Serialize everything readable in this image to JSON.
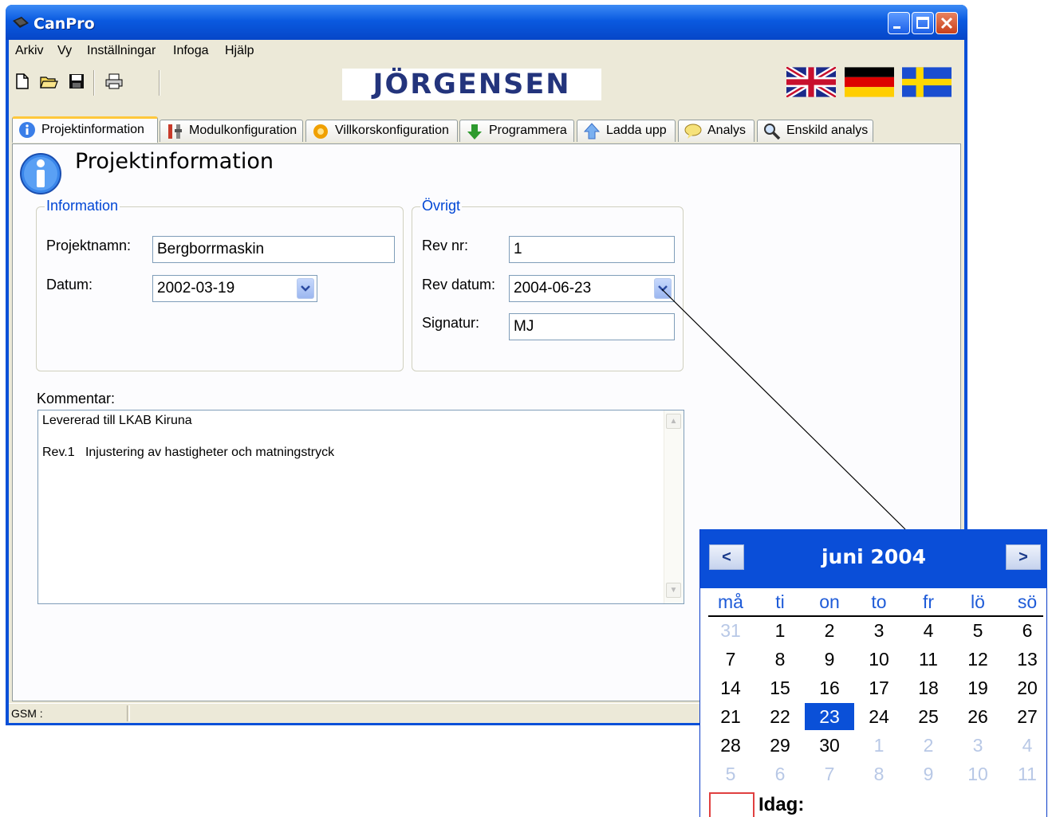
{
  "window": {
    "title": "CanPro"
  },
  "menu": [
    "Arkiv",
    "Vy",
    "Inställningar",
    "Infoga",
    "Hjälp"
  ],
  "toolbar": {
    "icons": [
      "new-file-icon",
      "open-folder-icon",
      "save-icon",
      "print-icon"
    ]
  },
  "logo": "JÖRGENSEN",
  "languages": [
    "flag-uk",
    "flag-germany",
    "flag-sweden"
  ],
  "tabs": [
    {
      "label": "Projektinformation",
      "active": true
    },
    {
      "label": "Modulkonfiguration"
    },
    {
      "label": "Villkorskonfiguration"
    },
    {
      "label": "Programmera"
    },
    {
      "label": "Ladda upp"
    },
    {
      "label": "Analys"
    },
    {
      "label": "Enskild analys"
    }
  ],
  "page": {
    "title": "Projektinformation"
  },
  "information": {
    "title": "Information",
    "projektnamn_label": "Projektnamn:",
    "projektnamn_value": "Bergborrmaskin",
    "datum_label": "Datum:",
    "datum_value": "2002-03-19"
  },
  "ovrigt": {
    "title": "Övrigt",
    "revnr_label": "Rev nr:",
    "revnr_value": "1",
    "revdatum_label": "Rev datum:",
    "revdatum_value": "2004-06-23",
    "signatur_label": "Signatur:",
    "signatur_value": "MJ"
  },
  "kommentar": {
    "label": "Kommentar:",
    "lines": [
      "Levererad till LKAB Kiruna",
      "Rev.1   Injustering av hastigheter och matningstryck"
    ]
  },
  "status": {
    "gsm": "GSM :"
  },
  "calendar": {
    "month": "juni 2004",
    "prev": "<",
    "next": ">",
    "weekdays": [
      "må",
      "ti",
      "on",
      "to",
      "fr",
      "lö",
      "sö"
    ],
    "weeks": [
      [
        "31",
        "1",
        "2",
        "3",
        "4",
        "5",
        "6"
      ],
      [
        "7",
        "8",
        "9",
        "10",
        "11",
        "12",
        "13"
      ],
      [
        "14",
        "15",
        "16",
        "17",
        "18",
        "19",
        "20"
      ],
      [
        "21",
        "22",
        "23",
        "24",
        "25",
        "26",
        "27"
      ],
      [
        "28",
        "29",
        "30",
        "1",
        "2",
        "3",
        "4"
      ],
      [
        "5",
        "6",
        "7",
        "8",
        "9",
        "10",
        "11"
      ]
    ],
    "selected": "23",
    "today_label": "Idag:",
    "colors": {
      "header": "#0a4ed8",
      "selected": "#0a50d8",
      "weekday_text": "#1e5bd8",
      "other_month": "#b8c8e6"
    }
  }
}
